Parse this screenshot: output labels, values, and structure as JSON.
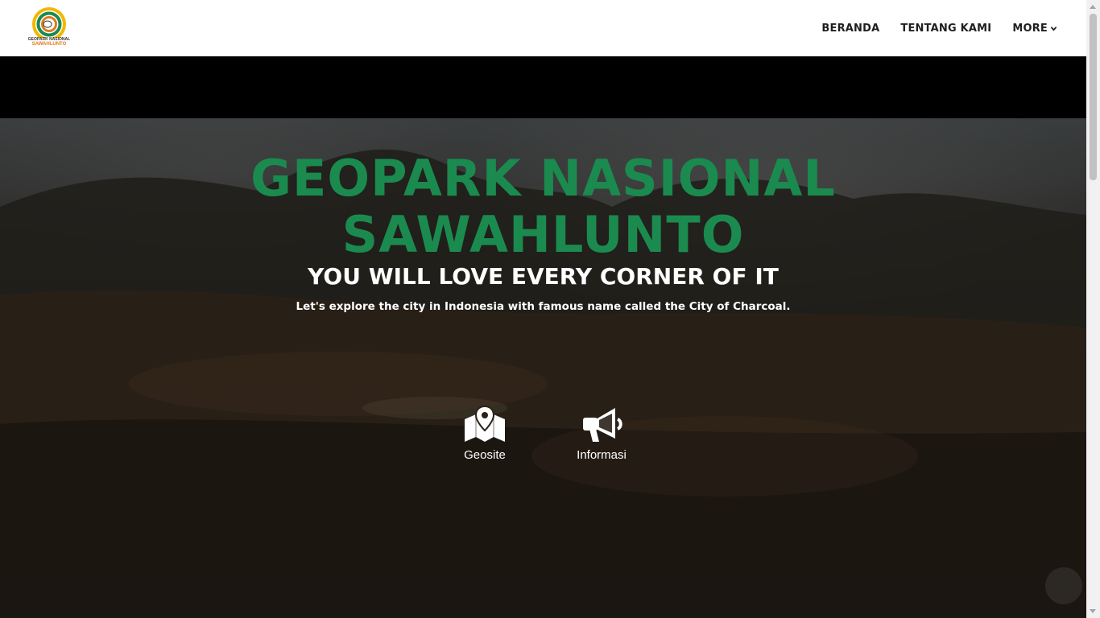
{
  "header": {
    "logo": {
      "line1": "GEOPARK NASIONAL",
      "line2": "SAWAHLUNTO",
      "colors": {
        "outer": "#f2b705",
        "middle": "#1b8a4f",
        "inner": "#e07a1f"
      }
    },
    "nav": [
      {
        "label": "BERANDA"
      },
      {
        "label": "TENTANG KAMI"
      },
      {
        "label": "MORE",
        "icon": "chevron-down-icon"
      }
    ]
  },
  "hero": {
    "title_line1": "GEOPARK NASIONAL",
    "title_line2": "SAWAHLUNTO",
    "subtitle": "YOU WILL LOVE EVERY CORNER OF IT",
    "description": "Let's explore the city in Indonesia with famous name called the City of Charcoal.",
    "actions": [
      {
        "label": "Geosite",
        "icon": "map-marker-icon"
      },
      {
        "label": "Informasi",
        "icon": "megaphone-icon"
      }
    ],
    "title_color": "#1b8a4f"
  }
}
